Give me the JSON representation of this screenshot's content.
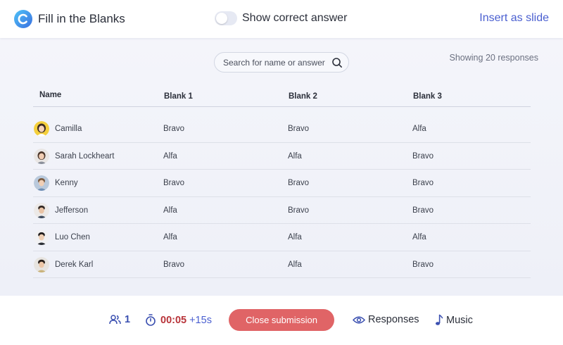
{
  "header": {
    "title": "Fill in the Blanks",
    "toggle_label": "Show correct answer",
    "toggle_on": false,
    "insert_label": "Insert as slide"
  },
  "search": {
    "placeholder": "Search for name or answer"
  },
  "showing_text": "Showing 20 responses",
  "table": {
    "columns": [
      "Name",
      "Blank 1",
      "Blank 2",
      "Blank 3"
    ],
    "rows": [
      {
        "name": "Camilla",
        "b1": "Bravo",
        "b2": "Bravo",
        "b3": "Alfa"
      },
      {
        "name": "Sarah Lockheart",
        "b1": "Alfa",
        "b2": "Alfa",
        "b3": "Bravo"
      },
      {
        "name": "Kenny",
        "b1": "Bravo",
        "b2": "Bravo",
        "b3": "Bravo"
      },
      {
        "name": "Jefferson",
        "b1": "Alfa",
        "b2": "Bravo",
        "b3": "Bravo"
      },
      {
        "name": "Luo Chen",
        "b1": "Alfa",
        "b2": "Alfa",
        "b3": "Alfa"
      },
      {
        "name": "Derek Karl",
        "b1": "Bravo",
        "b2": "Alfa",
        "b3": "Bravo"
      }
    ]
  },
  "footer": {
    "participants": "1",
    "time": "00:05",
    "time_extra": "+15s",
    "close_label": "Close submission",
    "responses_label": "Responses",
    "music_label": "Music"
  },
  "colors": {
    "accent": "#4a5fd0",
    "close_button": "#e06466",
    "timer": "#b8343a"
  },
  "icons": {
    "logo": "app-logo-icon",
    "search": "search-icon",
    "participants": "users-icon",
    "timer": "timer-icon",
    "responses": "eye-icon",
    "music": "music-note-icon"
  }
}
